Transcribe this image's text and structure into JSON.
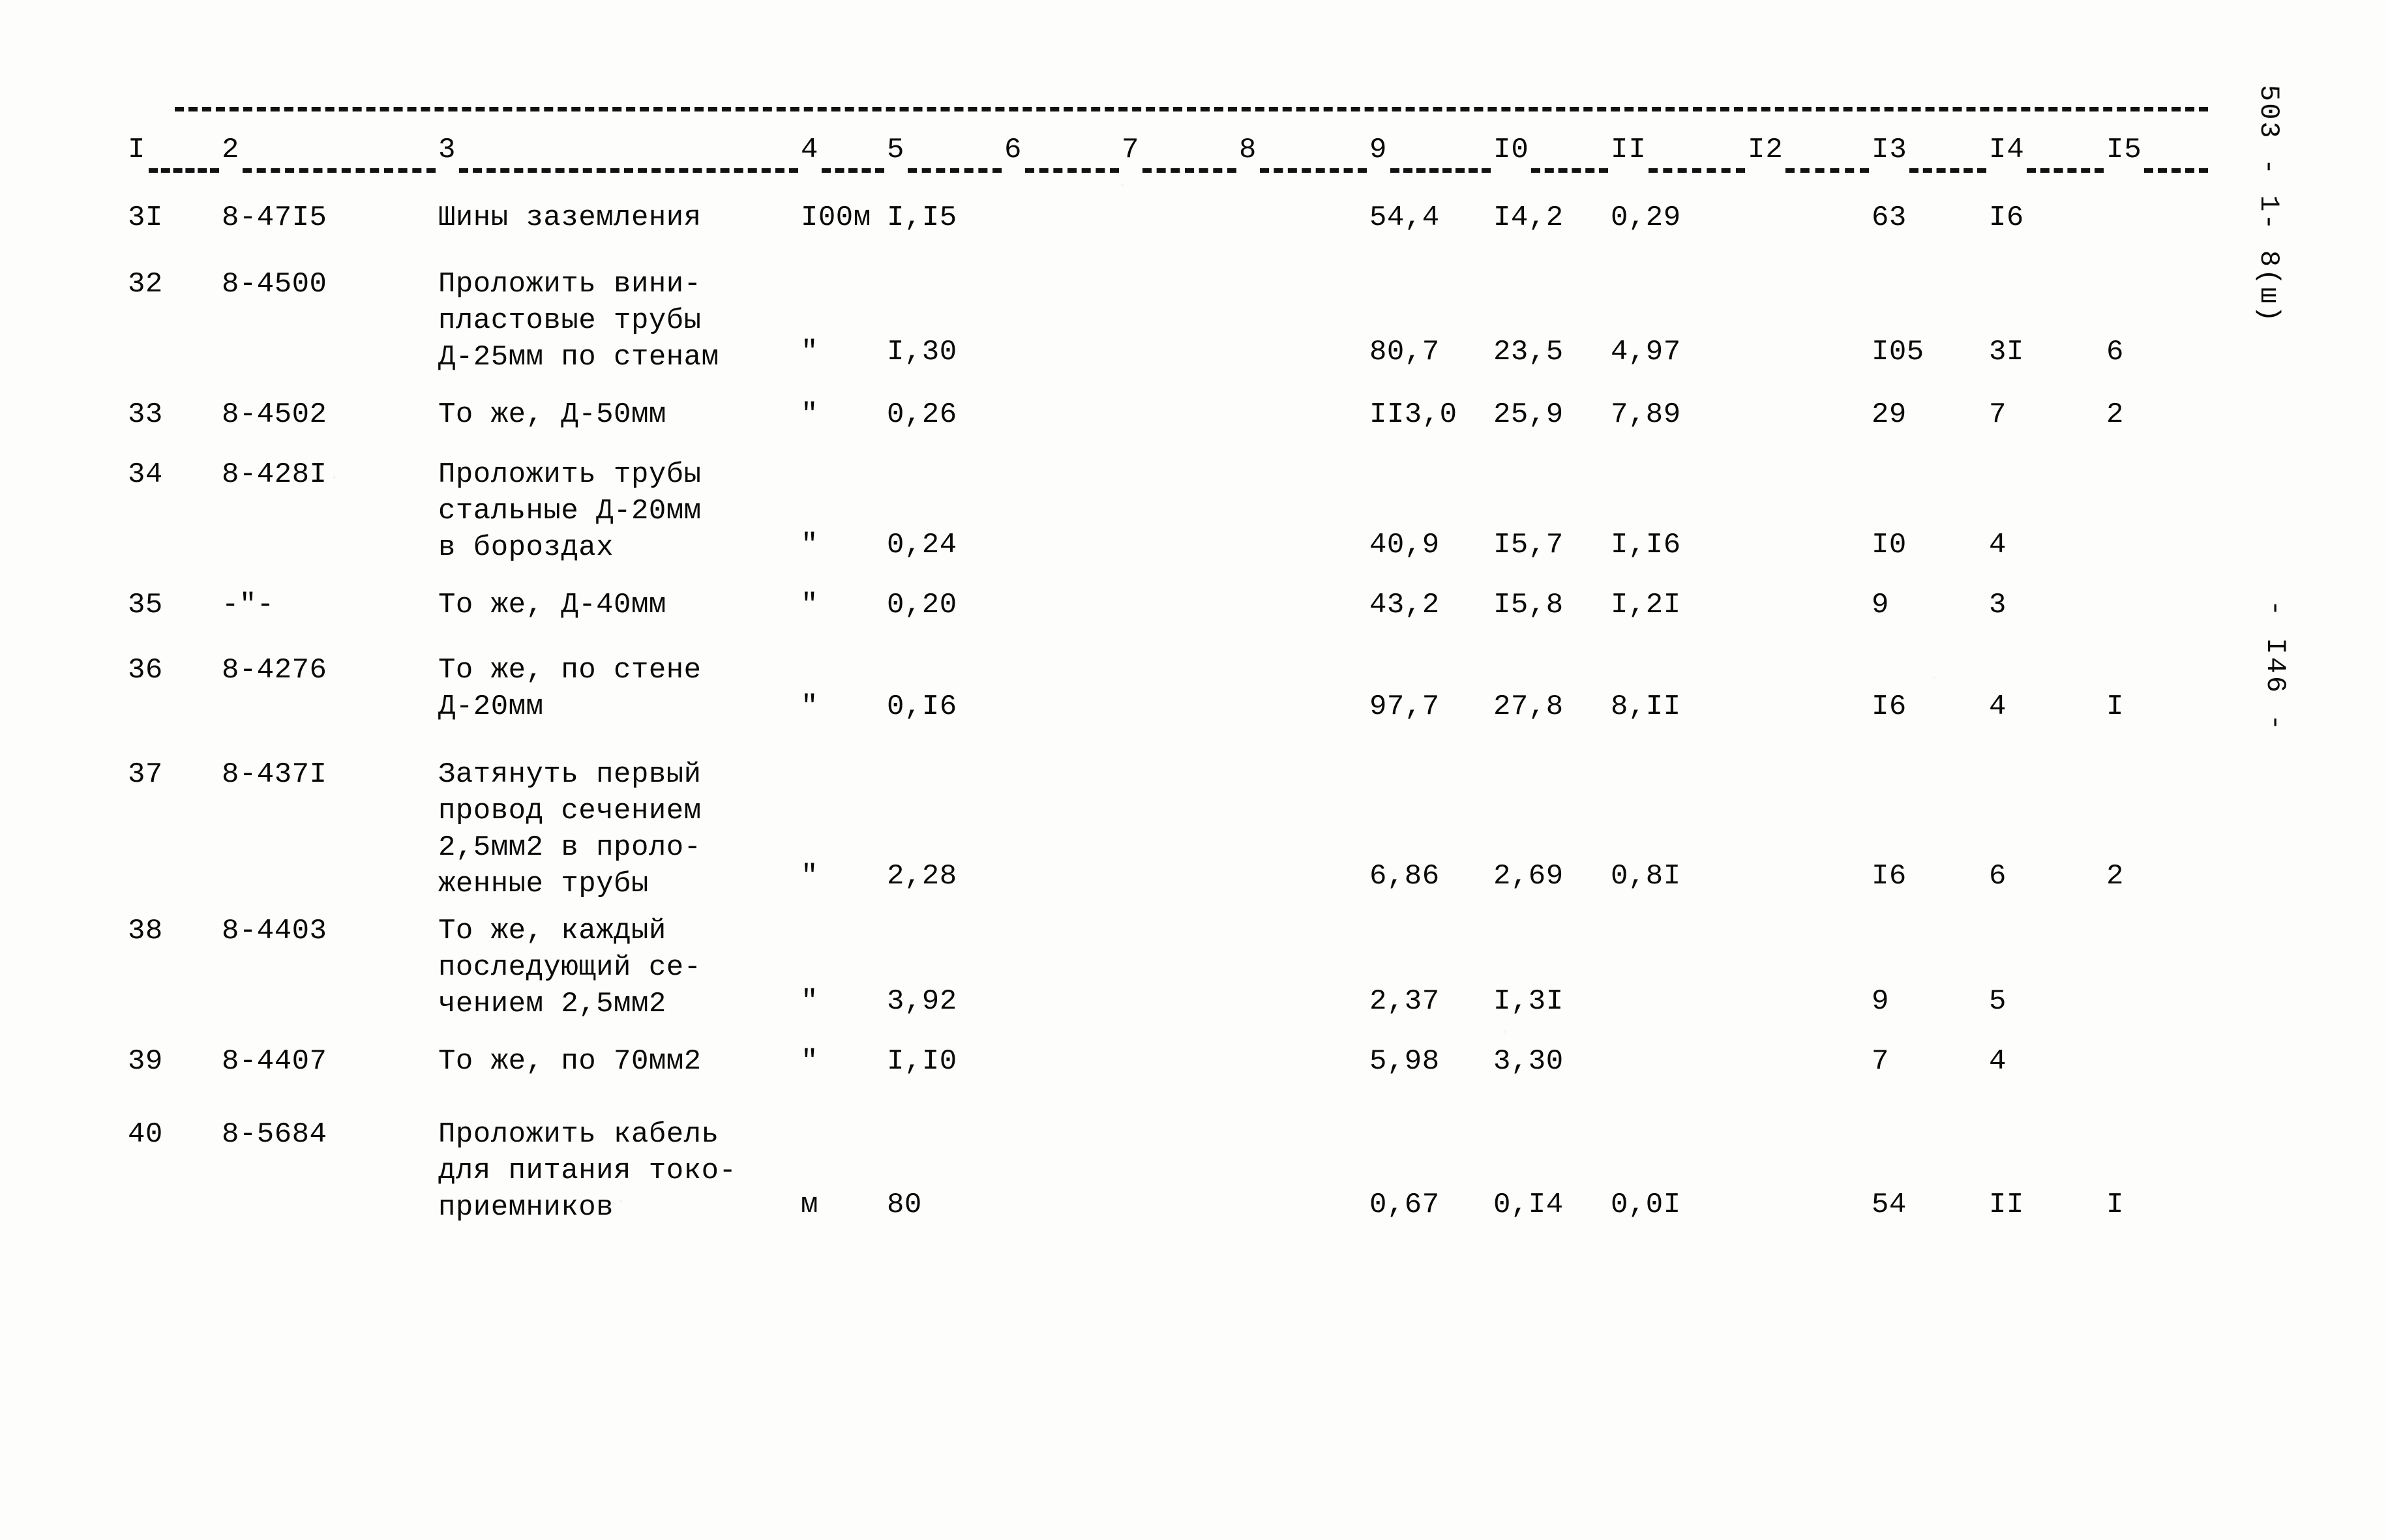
{
  "document": {
    "margin_code": "503 - 1- 8(ш)",
    "page_label": "- I46 -"
  },
  "table": {
    "column_headers": [
      "I",
      "2",
      "3",
      "4",
      "5",
      "6",
      "7",
      "8",
      "9",
      "I0",
      "II",
      "I2",
      "I3",
      "I4",
      "I5"
    ],
    "rows": [
      {
        "c1": "3I",
        "c2": "8-47I5",
        "c3": "Шины заземления",
        "c4": "I00м",
        "c5": "I,I5",
        "c6": "",
        "c7": "",
        "c8": "",
        "c9": "54,4",
        "c10": "I4,2",
        "c11": "0,29",
        "c12": "",
        "c13": "63",
        "c14": "I6",
        "c15": ""
      },
      {
        "c1": "32",
        "c2": "8-4500",
        "c3": "Проложить вини-\nпластовые трубы\nД-25мм по стенам",
        "c4": "\"",
        "c5": "I,30",
        "c6": "",
        "c7": "",
        "c8": "",
        "c9": "80,7",
        "c10": "23,5",
        "c11": "4,97",
        "c12": "",
        "c13": "I05",
        "c14": "3I",
        "c15": "6"
      },
      {
        "c1": "33",
        "c2": "8-4502",
        "c3": "То же, Д-50мм",
        "c4": "\"",
        "c5": "0,26",
        "c6": "",
        "c7": "",
        "c8": "",
        "c9": "II3,0",
        "c10": "25,9",
        "c11": "7,89",
        "c12": "",
        "c13": "29",
        "c14": "7",
        "c15": "2"
      },
      {
        "c1": "34",
        "c2": "8-428I",
        "c3": "Проложить трубы\nстальные Д-20мм\nв бороздах",
        "c4": "\"",
        "c5": "0,24",
        "c6": "",
        "c7": "",
        "c8": "",
        "c9": "40,9",
        "c10": "I5,7",
        "c11": "I,I6",
        "c12": "",
        "c13": "I0",
        "c14": "4",
        "c15": ""
      },
      {
        "c1": "35",
        "c2": "-\"-",
        "c3": "То же, Д-40мм",
        "c4": "\"",
        "c5": "0,20",
        "c6": "",
        "c7": "",
        "c8": "",
        "c9": "43,2",
        "c10": "I5,8",
        "c11": "I,2I",
        "c12": "",
        "c13": "9",
        "c14": "3",
        "c15": ""
      },
      {
        "c1": "36",
        "c2": "8-4276",
        "c3": "То же, по стене\nД-20мм",
        "c4": "\"",
        "c5": "0,I6",
        "c6": "",
        "c7": "",
        "c8": "",
        "c9": "97,7",
        "c10": "27,8",
        "c11": "8,II",
        "c12": "",
        "c13": "I6",
        "c14": "4",
        "c15": "I"
      },
      {
        "c1": "37",
        "c2": "8-437I",
        "c3": "Затянуть первый\nпровод сечением\n2,5мм2 в проло-\nженные трубы",
        "c4": "\"",
        "c5": "2,28",
        "c6": "",
        "c7": "",
        "c8": "",
        "c9": "6,86",
        "c10": "2,69",
        "c11": "0,8I",
        "c12": "",
        "c13": "I6",
        "c14": "6",
        "c15": "2"
      },
      {
        "c1": "38",
        "c2": "8-4403",
        "c3": "То же, каждый\nпоследующий се-\nчением 2,5мм2",
        "c4": "\"",
        "c5": "3,92",
        "c6": "",
        "c7": "",
        "c8": "",
        "c9": "2,37",
        "c10": "I,3I",
        "c11": "",
        "c12": "",
        "c13": "9",
        "c14": "5",
        "c15": ""
      },
      {
        "c1": "39",
        "c2": "8-4407",
        "c3": "То же, по 70мм2",
        "c4": "\"",
        "c5": "I,I0",
        "c6": "",
        "c7": "",
        "c8": "",
        "c9": "5,98",
        "c10": "3,30",
        "c11": "",
        "c12": "",
        "c13": "7",
        "c14": "4",
        "c15": ""
      },
      {
        "c1": "40",
        "c2": "8-5684",
        "c3": "Проложить кабель\nдля питания токо-\nприемников",
        "c4": "м",
        "c5": "80",
        "c6": "",
        "c7": "",
        "c8": "",
        "c9": "0,67",
        "c10": "0,I4",
        "c11": "0,0I",
        "c12": "",
        "c13": "54",
        "c14": "II",
        "c15": "I"
      }
    ]
  }
}
